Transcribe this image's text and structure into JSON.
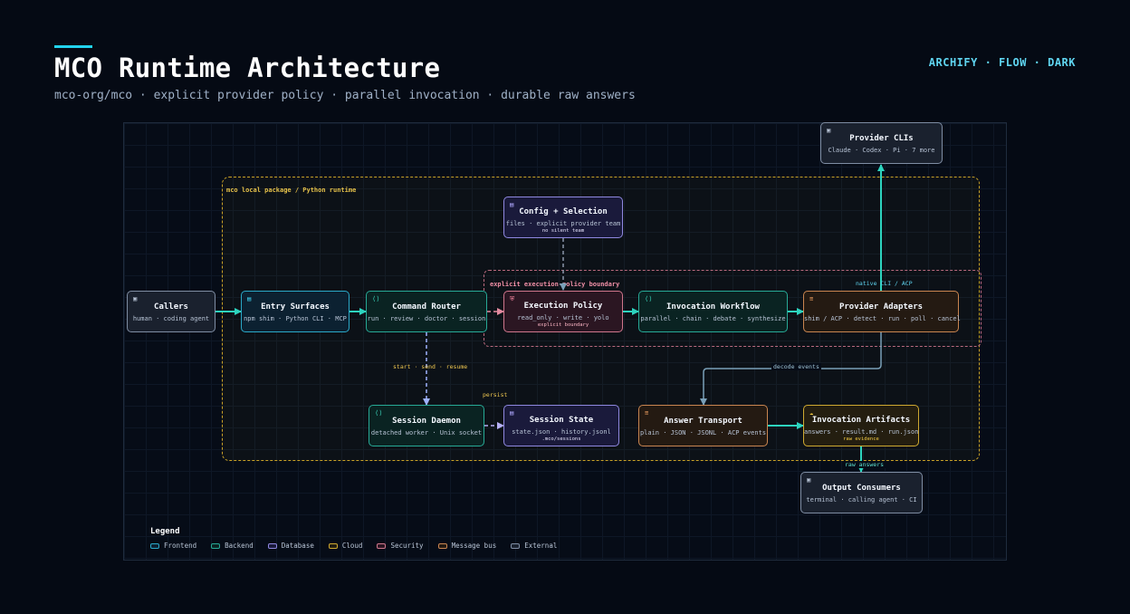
{
  "header": {
    "title": "MCO Runtime Architecture",
    "subtitle": "mco-org/mco · explicit provider policy · parallel invocation · durable raw answers",
    "brand": "ARCHIFY · FLOW · DARK"
  },
  "groups": {
    "package": "mco local package / Python runtime",
    "policy": "explicit execution-policy boundary"
  },
  "nodes": {
    "callers": {
      "title": "Callers",
      "sub": "human · coding agent"
    },
    "entry": {
      "title": "Entry Surfaces",
      "sub": "npm shim · Python CLI · MCP"
    },
    "router": {
      "title": "Command Router",
      "sub": "run · review · doctor · session"
    },
    "config": {
      "title": "Config + Selection",
      "sub": "files · explicit provider team",
      "note": "no silent team"
    },
    "policy": {
      "title": "Execution Policy",
      "sub": "read_only · write · yolo",
      "note": "explicit boundary"
    },
    "workflow": {
      "title": "Invocation Workflow",
      "sub": "parallel · chain · debate · synthesize"
    },
    "adapters": {
      "title": "Provider Adapters",
      "sub": "shim / ACP · detect · run · poll · cancel"
    },
    "clis": {
      "title": "Provider CLIs",
      "sub": "Claude · Codex · Pi · 7 more"
    },
    "daemon": {
      "title": "Session Daemon",
      "sub": "detached worker · Unix socket"
    },
    "state": {
      "title": "Session State",
      "sub": "state.json · history.jsonl",
      "note": ".mco/sessions"
    },
    "transport": {
      "title": "Answer Transport",
      "sub": "plain · JSON · JSONL · ACP events"
    },
    "artifacts": {
      "title": "Invocation Artifacts",
      "sub": "answers · result.md · run.json",
      "note": "raw evidence"
    },
    "consumers": {
      "title": "Output Consumers",
      "sub": "terminal · calling agent · CI"
    }
  },
  "edge_labels": {
    "native": "native CLI / ACP",
    "decode": "decode events",
    "session": "start · send · resume",
    "persist": "persist",
    "raw": "raw answers"
  },
  "icons": {
    "frontend": "window-icon",
    "backend": "code-braces-icon",
    "database": "database-icon",
    "security": "shield-icon",
    "bus": "queue-icon",
    "cloud": "cloud-icon",
    "external": "external-box-icon"
  },
  "legend": {
    "title": "Legend",
    "items": [
      "Frontend",
      "Backend",
      "Database",
      "Cloud",
      "Security",
      "Message bus",
      "External"
    ]
  },
  "colors": {
    "background": "#050a14",
    "accent": "#22d3ee",
    "edge": "#2dd4bf",
    "frontend": "#2aa8c8",
    "backend": "#27a996",
    "database": "#8f88e0",
    "cloud": "#cfa930",
    "security": "#d0768c",
    "bus": "#c98550",
    "external": "#7f8da3"
  }
}
